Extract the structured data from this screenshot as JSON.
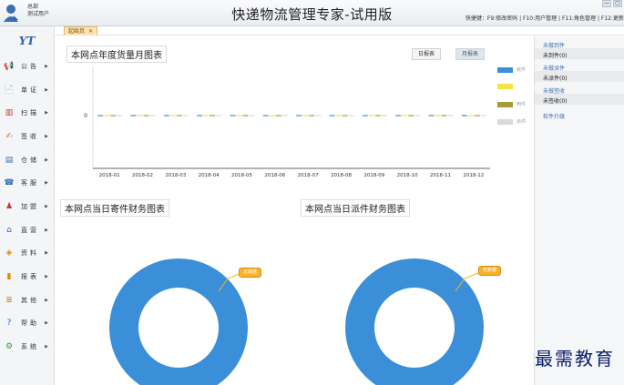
{
  "titlebar": {
    "user_line1": "总部",
    "user_line2": "测试用户",
    "app_title": "快递物流管理专家-试用版",
    "shortcuts": "快捷键：F9:修改密码 | F10:用户管理 | F11:角色管理 | F12:更新",
    "window_buttons": [
      "—",
      "▢"
    ]
  },
  "sidebar": {
    "logo": "YT",
    "items": [
      {
        "label": "公告",
        "icon": "megaphone-icon",
        "glyph": "📢",
        "color": "#d9534f"
      },
      {
        "label": "单证",
        "icon": "document-icon",
        "glyph": "📄",
        "color": "#666"
      },
      {
        "label": "扫描",
        "icon": "barcode-icon",
        "glyph": "▥",
        "color": "#c0392b"
      },
      {
        "label": "签收",
        "icon": "sign-icon",
        "glyph": "✍",
        "color": "#c77c2a"
      },
      {
        "label": "仓储",
        "icon": "warehouse-icon",
        "glyph": "▤",
        "color": "#3a6fb0"
      },
      {
        "label": "客服",
        "icon": "customer-service-icon",
        "glyph": "☎",
        "color": "#2b63b8"
      },
      {
        "label": "加盟",
        "icon": "franchise-icon",
        "glyph": "♟",
        "color": "#c0392b"
      },
      {
        "label": "直营",
        "icon": "direct-store-icon",
        "glyph": "⌂",
        "color": "#2b63b8"
      },
      {
        "label": "资料",
        "icon": "data-icon",
        "glyph": "◈",
        "color": "#e08a00"
      },
      {
        "label": "报表",
        "icon": "report-icon",
        "glyph": "▮",
        "color": "#e08a00"
      },
      {
        "label": "其他",
        "icon": "other-icon",
        "glyph": "≣",
        "color": "#c77c2a"
      },
      {
        "label": "帮助",
        "icon": "help-icon",
        "glyph": "?",
        "color": "#2b63b8"
      },
      {
        "label": "系统",
        "icon": "system-icon",
        "glyph": "⚙",
        "color": "#3a9a3a"
      }
    ]
  },
  "tabs": [
    {
      "label": "起始页",
      "close": "✕"
    }
  ],
  "main": {
    "monthly_title": "本网点年度货量月图表",
    "toggle_day": "日报表",
    "toggle_month": "月报表",
    "send_finance_title": "本网点当日寄件财务图表",
    "dispatch_finance_title": "本网点当日派件财务图表",
    "no_data": "无数据"
  },
  "right_panel": {
    "sections": [
      {
        "heading": "未做到件",
        "value": "未到件(0)"
      },
      {
        "heading": "未做派件",
        "value": "未派件(0)"
      },
      {
        "heading": "未做签收",
        "value": "未签收(0)"
      }
    ],
    "link": "软件升级"
  },
  "colors": {
    "donut": "#3a8fd8",
    "series_1": "#3a8fd8",
    "series_2": "#f5e342",
    "series_3": "#a89a3a",
    "series_4": "#d9d9d9"
  },
  "chart_data": {
    "type": "bar",
    "title": "本网点年度货量月图表",
    "categories": [
      "2018-01",
      "2018-02",
      "2018-03",
      "2018-04",
      "2018-05",
      "2018-06",
      "2018-07",
      "2018-08",
      "2018-09",
      "2018-10",
      "2018-11",
      "2018-12"
    ],
    "series": [
      {
        "name": "收件",
        "values": [
          0,
          0,
          0,
          0,
          0,
          0,
          0,
          0,
          0,
          0,
          0,
          0
        ]
      },
      {
        "name": "",
        "values": [
          0,
          0,
          0,
          0,
          0,
          0,
          0,
          0,
          0,
          0,
          0,
          0
        ]
      },
      {
        "name": "到件",
        "values": [
          0,
          0,
          0,
          0,
          0,
          0,
          0,
          0,
          0,
          0,
          0,
          0
        ]
      },
      {
        "name": "派件",
        "values": [
          0,
          0,
          0,
          0,
          0,
          0,
          0,
          0,
          0,
          0,
          0,
          0
        ]
      }
    ],
    "yticks": [
      "0"
    ],
    "legend": "right",
    "grid": false
  },
  "watermark": "最需教育"
}
